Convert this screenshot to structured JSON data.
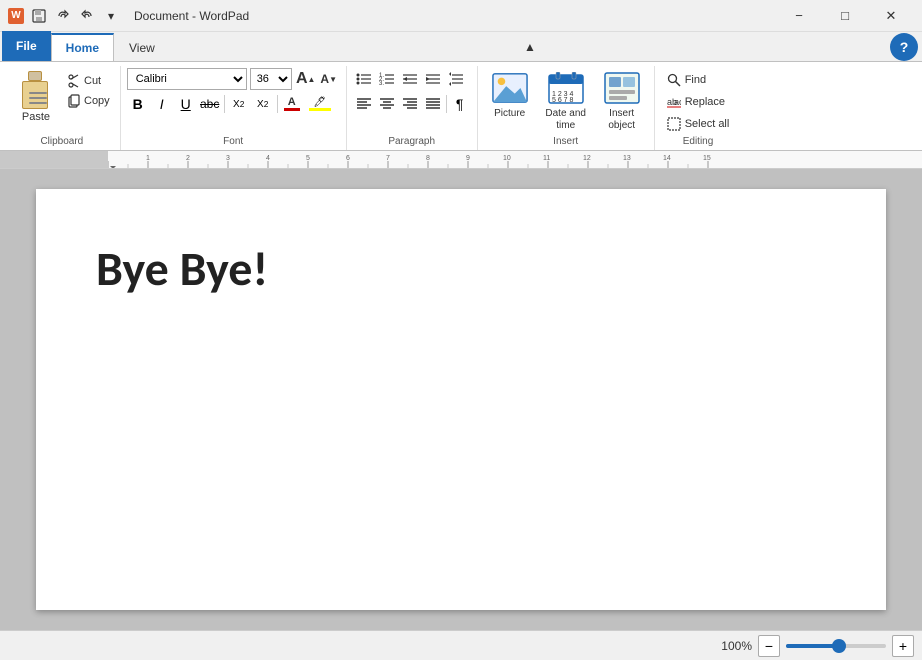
{
  "titleBar": {
    "title": "Document - WordPad",
    "quickAccess": [
      "save",
      "undo",
      "redo",
      "dropdown"
    ]
  },
  "tabs": {
    "items": [
      "File",
      "Home",
      "View"
    ],
    "active": "Home"
  },
  "clipboard": {
    "label": "Clipboard",
    "paste_label": "Paste",
    "cut_label": "Cut",
    "copy_label": "Copy"
  },
  "font": {
    "label": "Font",
    "name": "Calibri",
    "size": "36",
    "grow_label": "A",
    "shrink_label": "A",
    "bold_label": "B",
    "italic_label": "I",
    "underline_label": "U",
    "strikethrough_label": "abc",
    "subscript_label": "X₂",
    "superscript_label": "X²"
  },
  "paragraph": {
    "label": "Paragraph"
  },
  "insert": {
    "label": "Insert",
    "picture_label": "Picture",
    "datetime_label": "Date and\ntime",
    "object_label": "Insert\nobject"
  },
  "editing": {
    "label": "Editing",
    "find_label": "Find",
    "replace_label": "Replace",
    "select_label": "Select all"
  },
  "document": {
    "content": "Bye Bye!"
  },
  "statusBar": {
    "zoom_percent": "100%",
    "zoom_minus": "−",
    "zoom_plus": "+"
  },
  "icons": {
    "undo": "↩",
    "redo": "↪",
    "save": "💾",
    "minimize": "−",
    "maximize": "□",
    "close": "✕",
    "bold": "B",
    "italic": "I",
    "underline": "U",
    "help": "?"
  }
}
